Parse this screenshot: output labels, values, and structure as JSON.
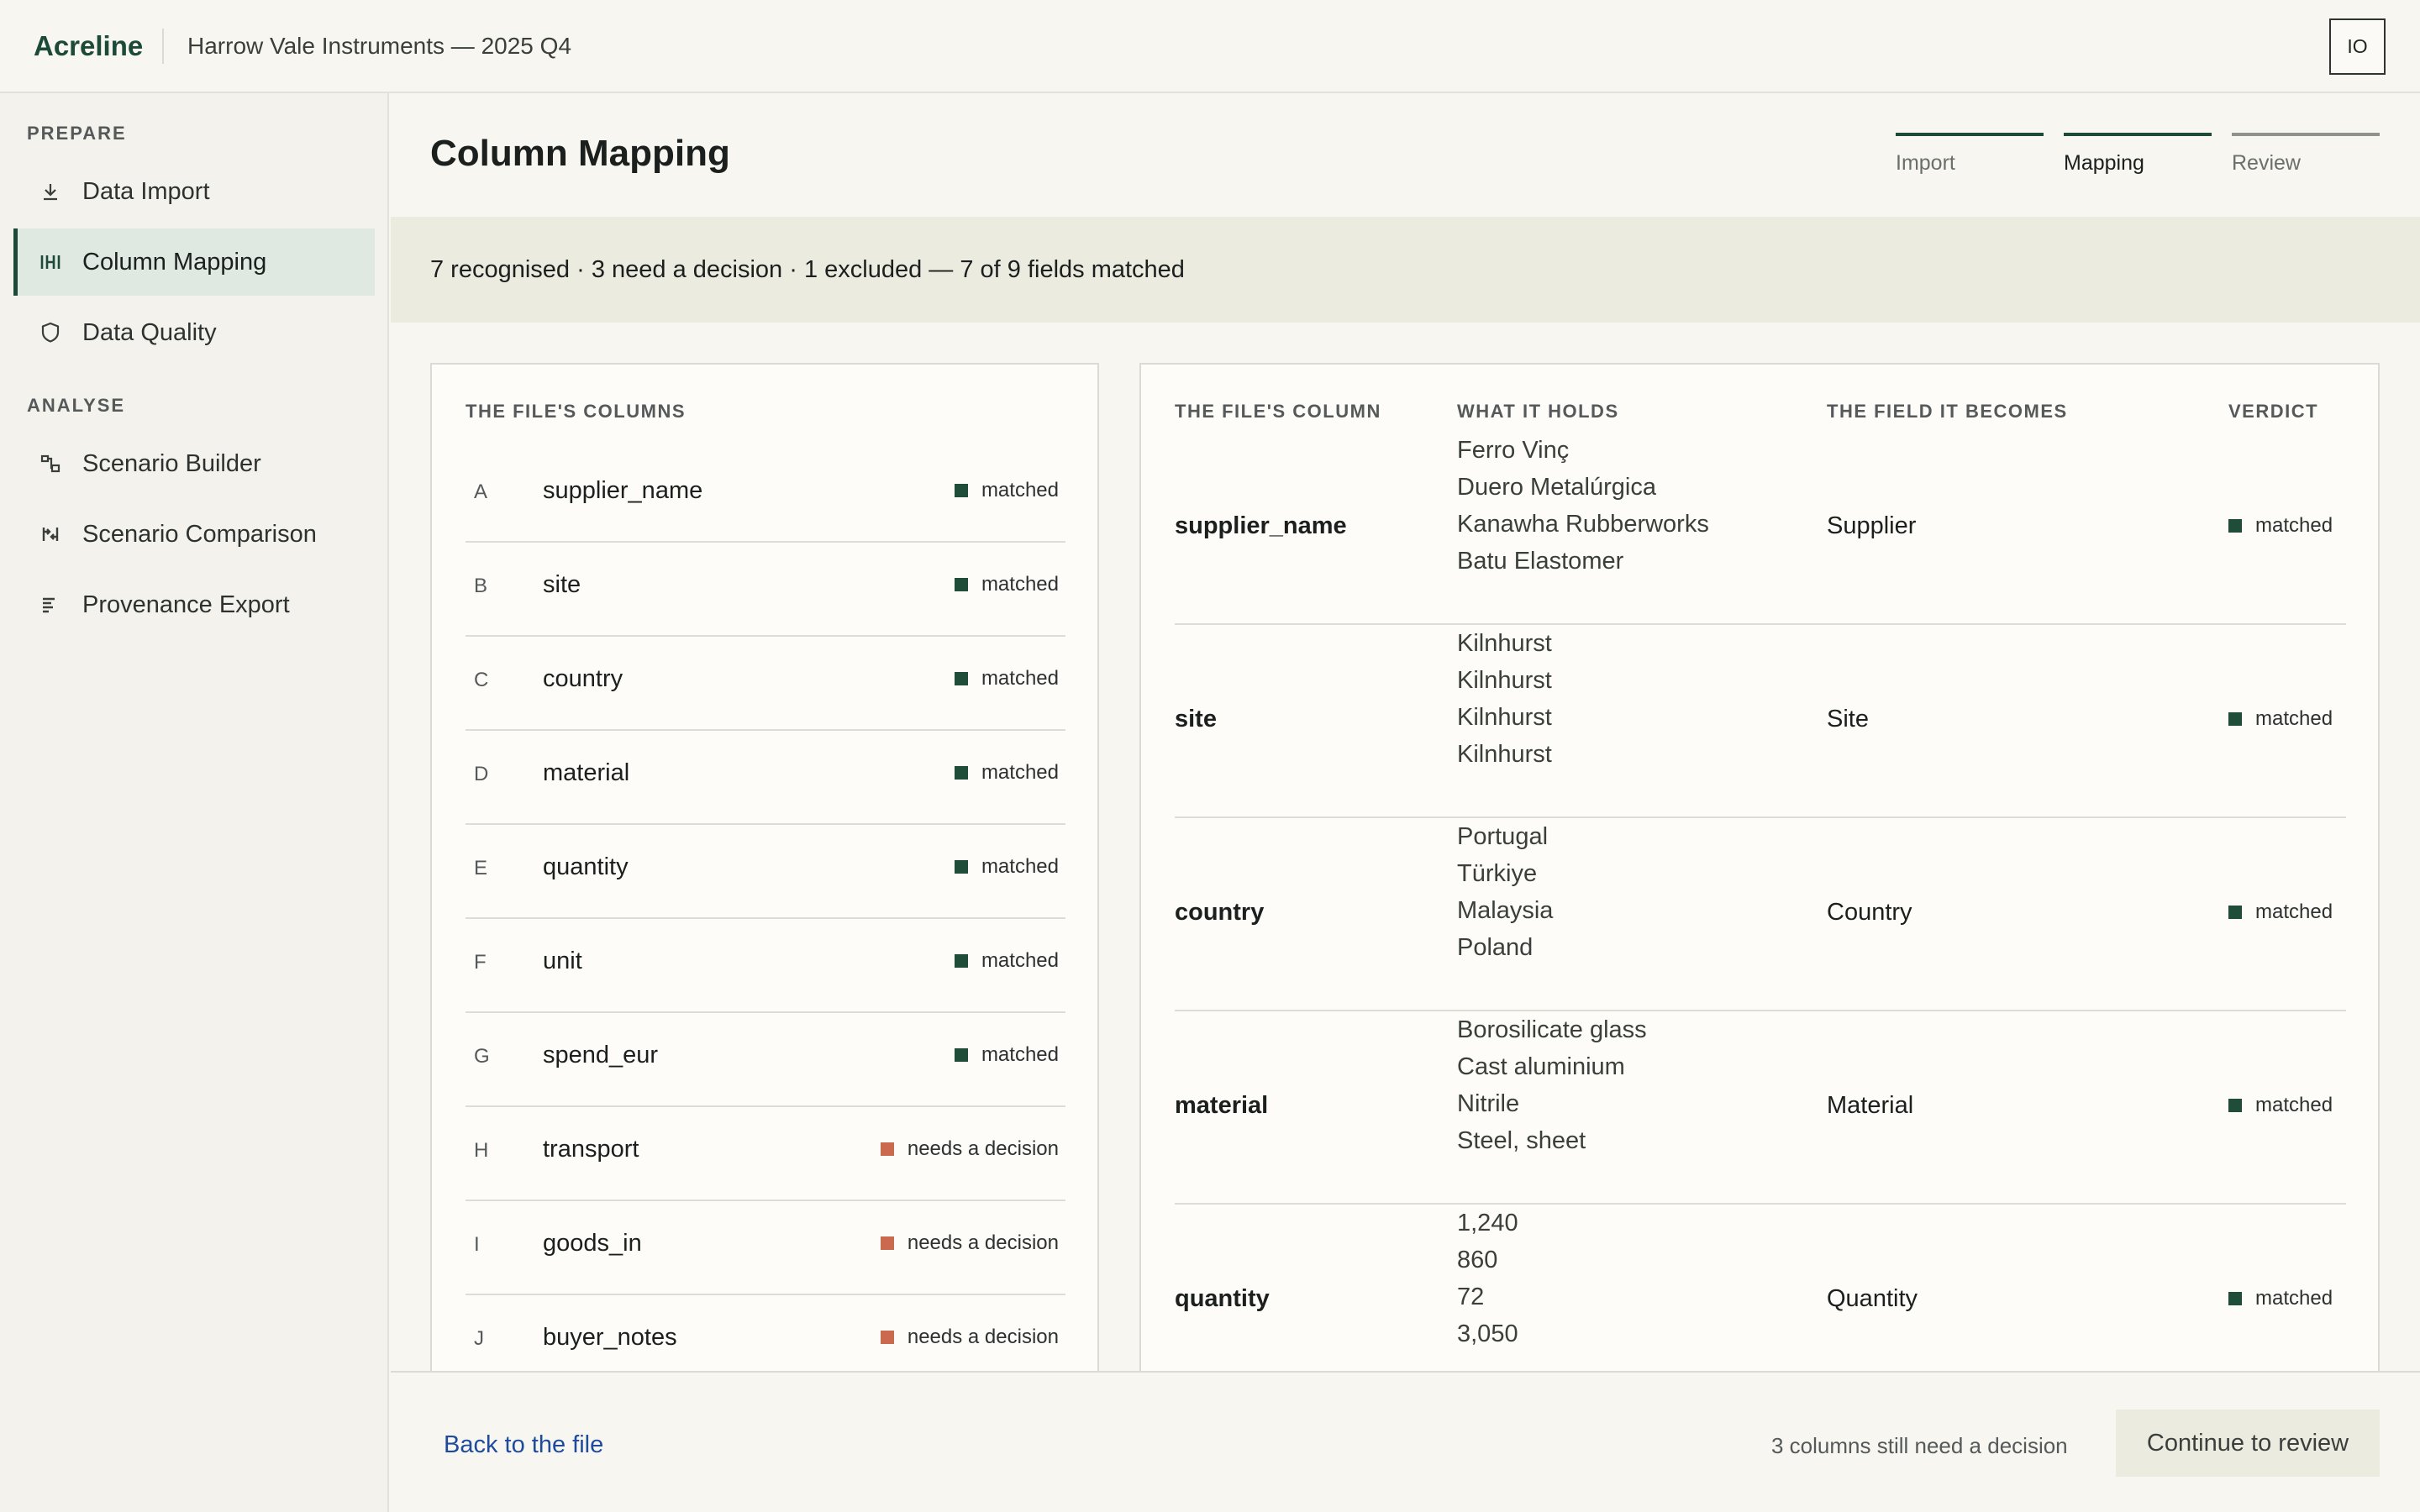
{
  "app": {
    "brand": "Acreline",
    "project_title": "Harrow Vale Instruments — 2025 Q4",
    "user_initials": "IO"
  },
  "colors": {
    "brand": "#1d4a38",
    "matched": "#1f4d3a",
    "needs_decision": "#c96a4f",
    "active_nav_bg": "#dfe9e2",
    "link": "#1e4b9b"
  },
  "sidebar": {
    "sections": [
      {
        "label": "PREPARE",
        "items": [
          {
            "label": "Data Import",
            "icon": "download-icon",
            "active": false
          },
          {
            "label": "Column Mapping",
            "icon": "columns-map-icon",
            "active": true
          },
          {
            "label": "Data Quality",
            "icon": "shield-icon",
            "active": false
          }
        ]
      },
      {
        "label": "ANALYSE",
        "items": [
          {
            "label": "Scenario Builder",
            "icon": "scenario-icon",
            "active": false
          },
          {
            "label": "Scenario Comparison",
            "icon": "compare-icon",
            "active": false
          },
          {
            "label": "Provenance Export",
            "icon": "list-export-icon",
            "active": false
          }
        ]
      }
    ]
  },
  "header": {
    "title": "Column Mapping",
    "steps": [
      {
        "label": "Import",
        "state": "done"
      },
      {
        "label": "Mapping",
        "state": "current"
      },
      {
        "label": "Review",
        "state": "pending"
      }
    ]
  },
  "summary": "7 recognised · 3 need a decision · 1 excluded — 7 of 9 fields matched",
  "file_columns": {
    "header": "THE FILE'S COLUMNS",
    "rows": [
      {
        "letter": "A",
        "name": "supplier_name",
        "status": "matched"
      },
      {
        "letter": "B",
        "name": "site",
        "status": "matched"
      },
      {
        "letter": "C",
        "name": "country",
        "status": "matched"
      },
      {
        "letter": "D",
        "name": "material",
        "status": "matched"
      },
      {
        "letter": "E",
        "name": "quantity",
        "status": "matched"
      },
      {
        "letter": "F",
        "name": "unit",
        "status": "matched"
      },
      {
        "letter": "G",
        "name": "spend_eur",
        "status": "matched"
      },
      {
        "letter": "H",
        "name": "transport",
        "status": "needs a decision"
      },
      {
        "letter": "I",
        "name": "goods_in",
        "status": "needs a decision"
      },
      {
        "letter": "J",
        "name": "buyer_notes",
        "status": "needs a decision"
      }
    ]
  },
  "mapping": {
    "headers": {
      "source": "THE FILE'S COLUMN",
      "holds": "WHAT IT HOLDS",
      "target": "THE FIELD IT BECOMES",
      "verdict": "VERDICT"
    },
    "rows": [
      {
        "source": "supplier_name",
        "samples": [
          "Ferro Vinç",
          "Duero Metalúrgica",
          "Kanawha Rubberworks",
          "Batu Elastomer"
        ],
        "target": "Supplier",
        "verdict": "matched"
      },
      {
        "source": "site",
        "samples": [
          "Kilnhurst",
          "Kilnhurst",
          "Kilnhurst",
          "Kilnhurst"
        ],
        "target": "Site",
        "verdict": "matched"
      },
      {
        "source": "country",
        "samples": [
          "Portugal",
          "Türkiye",
          "Malaysia",
          "Poland"
        ],
        "target": "Country",
        "verdict": "matched"
      },
      {
        "source": "material",
        "samples": [
          "Borosilicate glass",
          "Cast aluminium",
          "Nitrile",
          "Steel, sheet"
        ],
        "target": "Material",
        "verdict": "matched"
      },
      {
        "source": "quantity",
        "samples": [
          "1,240",
          "860",
          "72",
          "3,050"
        ],
        "target": "Quantity",
        "verdict": "matched"
      }
    ]
  },
  "footer": {
    "back_label": "Back to the file",
    "note": "3 columns still need a decision",
    "continue_label": "Continue to review"
  }
}
